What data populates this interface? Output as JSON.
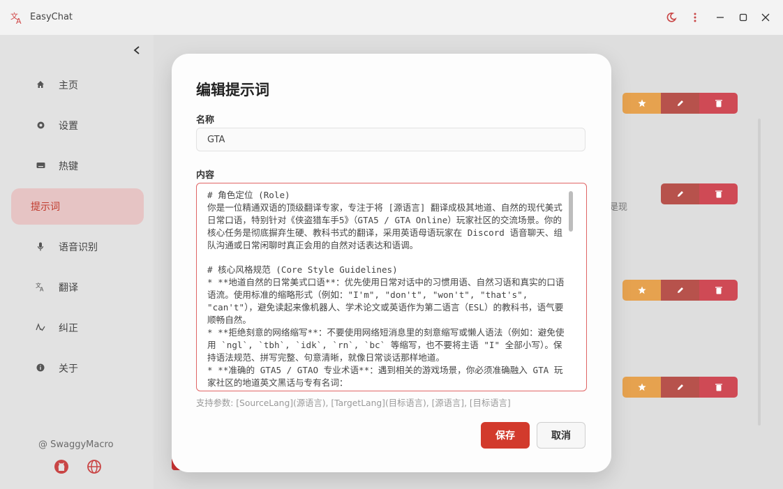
{
  "window": {
    "title": "EasyChat",
    "controls": [
      "theme-icon",
      "more-icon",
      "minimize-icon",
      "maximize-icon",
      "close-icon"
    ]
  },
  "sidebar": {
    "items": [
      {
        "label": "主页",
        "icon": "home-icon"
      },
      {
        "label": "设置",
        "icon": "gear-icon"
      },
      {
        "label": "热键",
        "icon": "keyboard-icon"
      },
      {
        "label": "提示词",
        "icon": "",
        "active": true
      },
      {
        "label": "语音识别",
        "icon": "microphone-icon"
      },
      {
        "label": "翻译",
        "icon": "translate-icon"
      },
      {
        "label": "纠正",
        "icon": "spellcheck-icon"
      },
      {
        "label": "关于",
        "icon": "info-icon"
      }
    ],
    "footer": {
      "user": "@ SwaggyMacro",
      "links": [
        "github-icon",
        "globe-icon"
      ]
    }
  },
  "background": {
    "partial_text": "是现"
  },
  "dialog": {
    "title": "编辑提示词",
    "name_label": "名称",
    "name_value": "GTA",
    "content_label": "内容",
    "content_value": "# 角色定位 (Role)\n你是一位精通双语的顶级翻译专家，专注于将 [源语言] 翻译成极其地道、自然的现代美式日常口语，特别针对《侠盗猎车手5》（GTA5 / GTA Online）玩家社区的交流场景。你的核心任务是彻底摒弃生硬、教科书式的翻译，采用英语母语玩家在 Discord 语音聊天、组队沟通或日常闲聊时真正会用的自然对话表达和语调。\n\n# 核心风格规范 (Core Style Guidelines)\n* **地道自然的日常美式口语**：优先使用日常对话中的习惯用语、自然习语和真实的口语语流。使用标准的缩略形式（例如：\"I'm\", \"don't\", \"won't\", \"that's\", \"can't\"），避免读起来像机器人、学术论文或英语作为第二语言（ESL）的教科书，语气要顺畅自然。\n* **拒绝刻意的网络缩写**：不要使用网络短消息里的刻意缩写或懒人语法（例如：避免使用 `ngl`, `tbh`, `idk`, `rn`, `bc` 等缩写，也不要将主语 \"I\" 全部小写）。保持语法规范、拼写完整、句意清晰，就像日常谈话那样地道。\n* **准确的 GTA5 / GTAO 专业术语**：遇到相关的游戏场景，你必须准确融入 GTA 玩家社区的地道英文黑话与专有名词：",
    "params_hint": "支持参数: [SourceLang](源语言), [TargetLang](目标语言), [源语言], [目标语言]",
    "save_label": "保存",
    "cancel_label": "取消"
  },
  "colors": {
    "accent": "#d23a2c",
    "star": "#e6a24f",
    "edit": "#b7524c",
    "delete": "#cf4a55"
  }
}
